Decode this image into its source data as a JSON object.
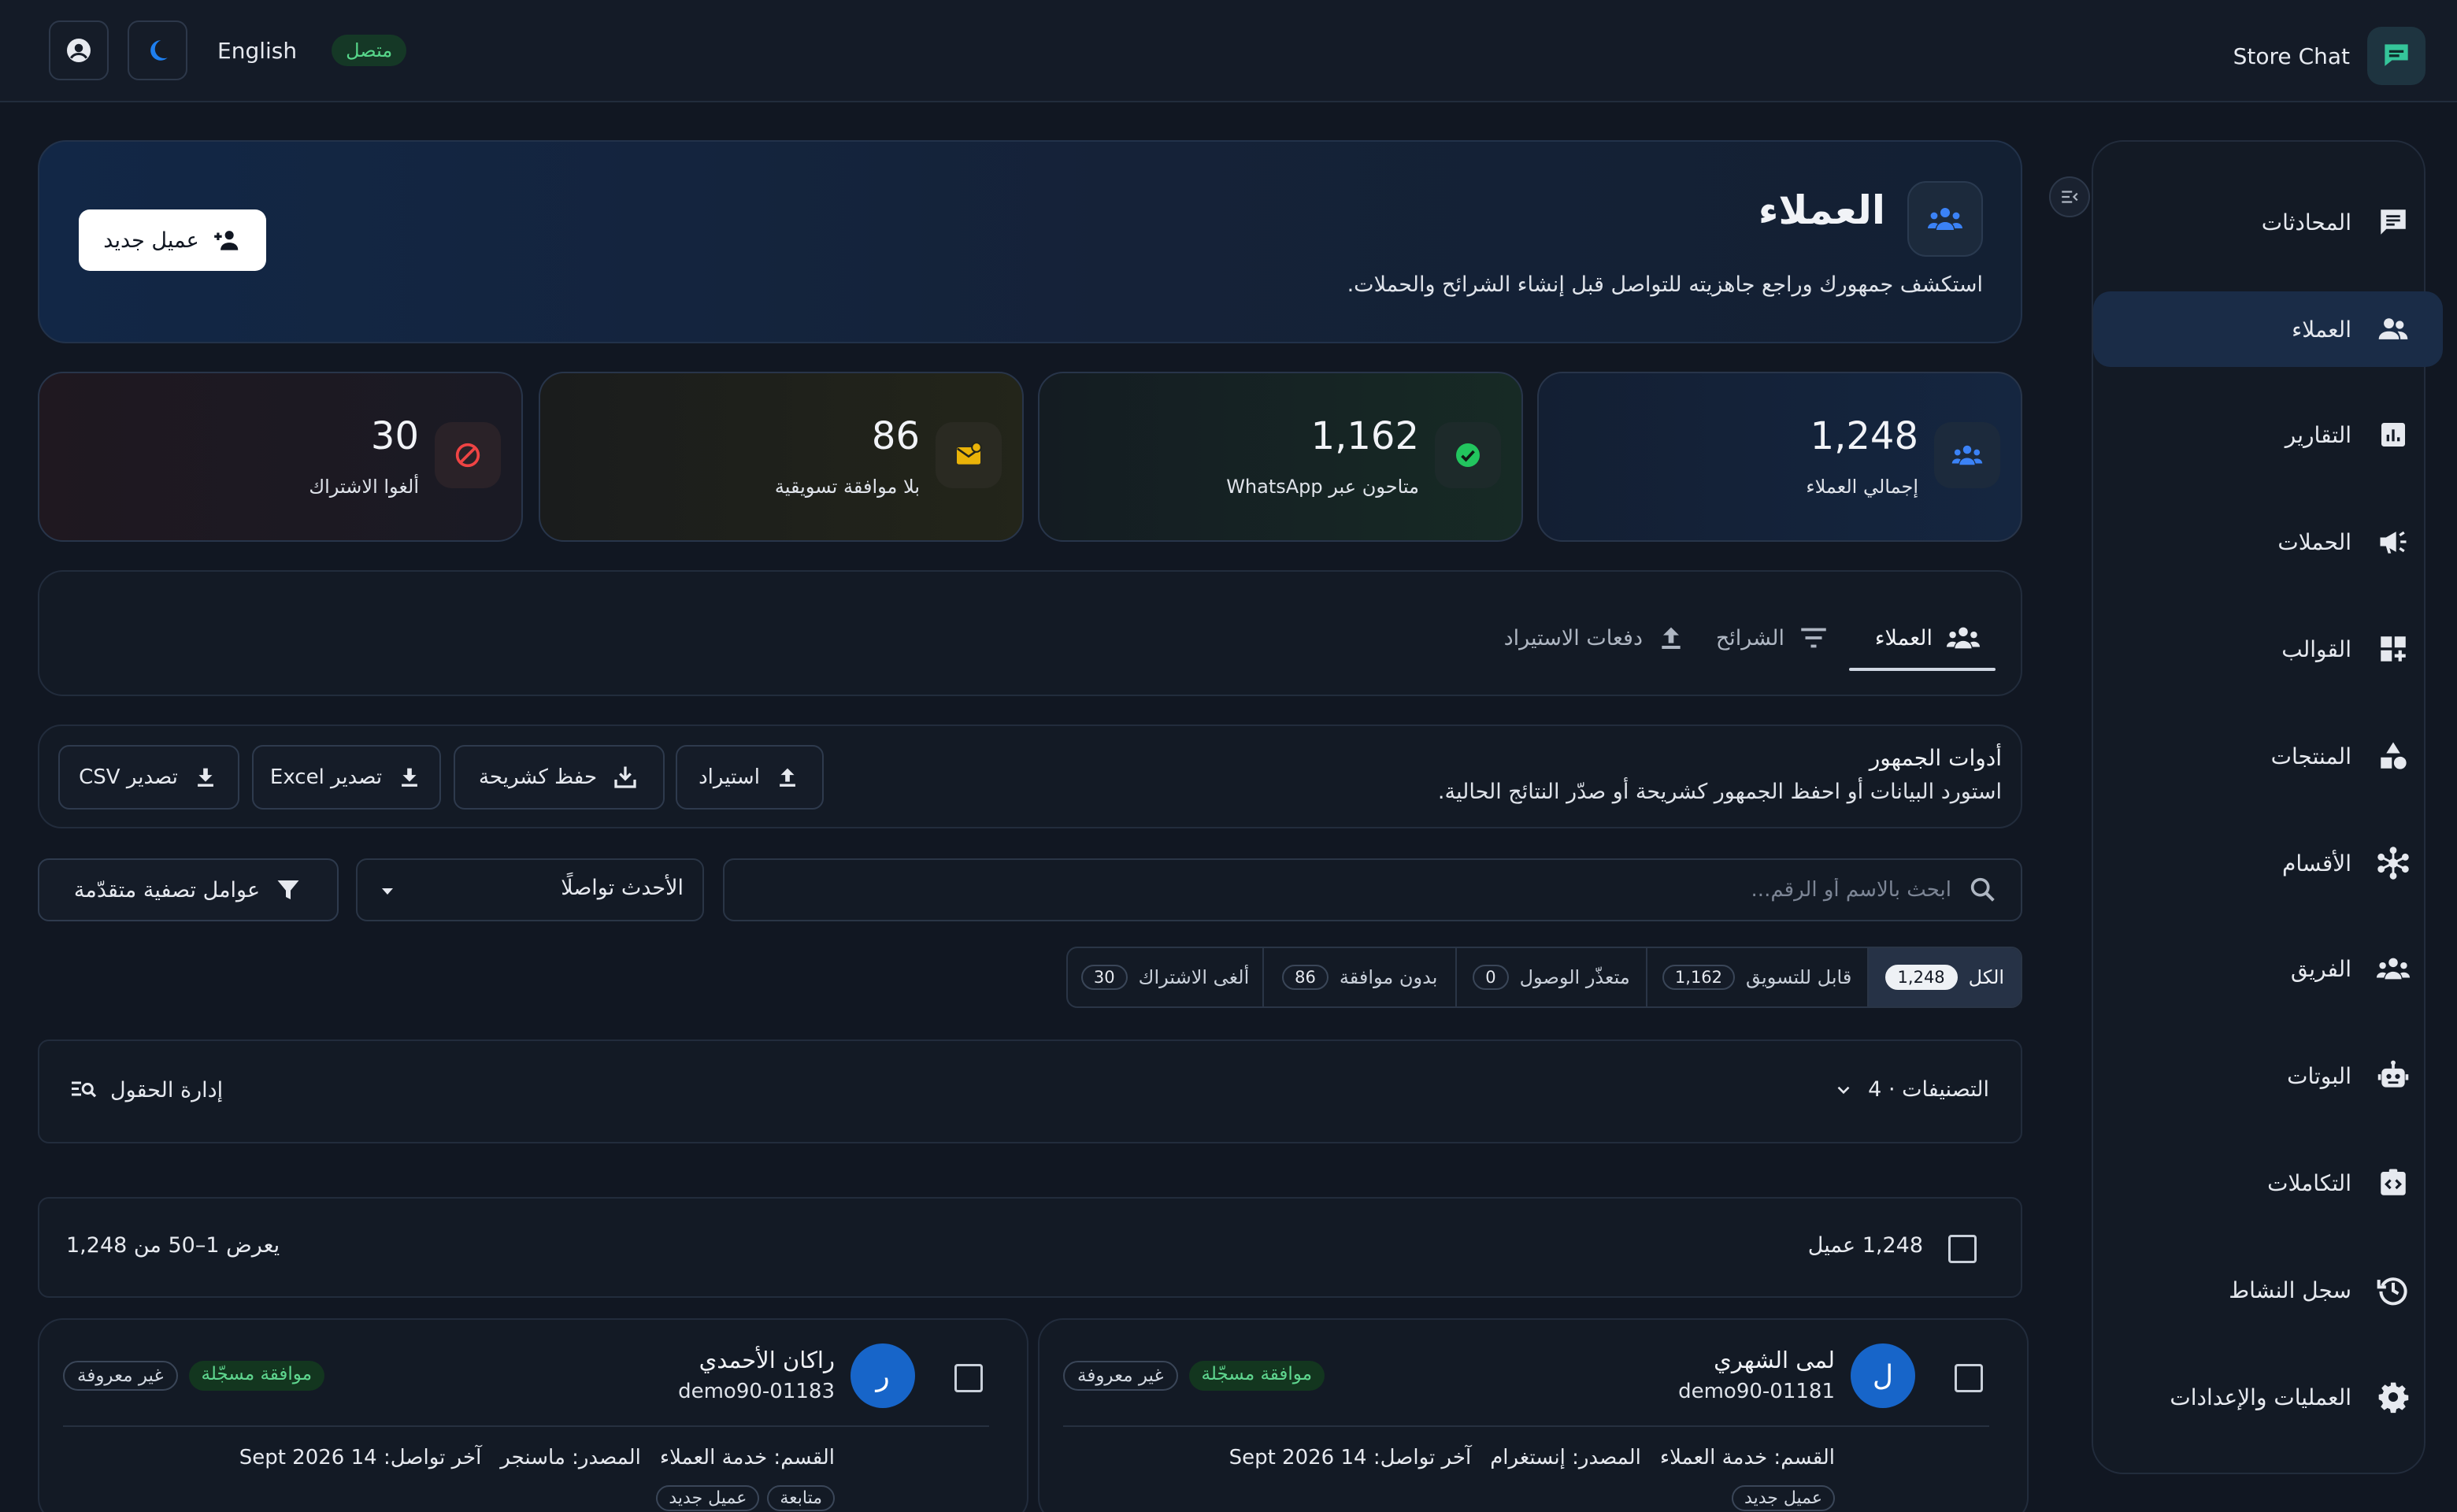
{
  "topbar": {
    "brand": "Store Chat",
    "language": "English",
    "status": "متصل"
  },
  "sidebar": {
    "items": [
      {
        "label": "المحادثات",
        "icon": "chat-icon"
      },
      {
        "label": "العملاء",
        "icon": "people-icon",
        "active": true
      },
      {
        "label": "التقارير",
        "icon": "report-icon"
      },
      {
        "label": "الحملات",
        "icon": "megaphone-icon"
      },
      {
        "label": "القوالب",
        "icon": "template-icon"
      },
      {
        "label": "المنتجات",
        "icon": "shapes-icon"
      },
      {
        "label": "الأقسام",
        "icon": "hub-icon"
      },
      {
        "label": "الفريق",
        "icon": "team-icon"
      },
      {
        "label": "البوتات",
        "icon": "bot-icon"
      },
      {
        "label": "التكاملات",
        "icon": "integration-icon"
      },
      {
        "label": "سجل النشاط",
        "icon": "history-icon"
      },
      {
        "label": "العمليات والإعدادات",
        "icon": "gear-icon"
      }
    ]
  },
  "hero": {
    "title": "العملاء",
    "subtitle": "استكشف جمهورك وراجع جاهزيته للتواصل قبل إنشاء الشرائح والحملات.",
    "new_button": "عميل جديد"
  },
  "stats": [
    {
      "value": "1,248",
      "label": "إجمالي العملاء",
      "color": "#3b82f6"
    },
    {
      "value": "1,162",
      "label": "متاحون عبر WhatsApp",
      "color": "#22c55e"
    },
    {
      "value": "86",
      "label": "بلا موافقة تسويقية",
      "color": "#eab308"
    },
    {
      "value": "30",
      "label": "ألغوا الاشتراك",
      "color": "#ef4444"
    }
  ],
  "tabs": [
    {
      "label": "العملاء",
      "active": true
    },
    {
      "label": "الشرائح"
    },
    {
      "label": "دفعات الاستيراد"
    }
  ],
  "tools": {
    "title": "أدوات الجمهور",
    "subtitle": "استورد البيانات أو احفظ الجمهور كشريحة أو صدّر النتائج الحالية.",
    "import": "استيراد",
    "save_segment": "حفظ كشريحة",
    "export_excel": "تصدير Excel",
    "export_csv": "تصدير CSV"
  },
  "search": {
    "placeholder": "ابحث بالاسم أو الرقم..."
  },
  "sort": {
    "selected": "الأحدث تواصلًا"
  },
  "filter_button": "عوامل تصفية متقدّمة",
  "segments": [
    {
      "label": "الكل",
      "count": "1,248",
      "active": true
    },
    {
      "label": "قابل للتسويق",
      "count": "1,162"
    },
    {
      "label": "متعذّر الوصول",
      "count": "0"
    },
    {
      "label": "بدون موافقة",
      "count": "86"
    },
    {
      "label": "ألغى الاشتراك",
      "count": "30"
    }
  ],
  "categories": {
    "label": "التصنيفات · 4",
    "manage_fields": "إدارة الحقول"
  },
  "list": {
    "count_label": "1,248 عميل",
    "range_label": "يعرض 1–50 من 1,248"
  },
  "customers": [
    {
      "initial": "ل",
      "name": "لمى الشهري",
      "id": "demo90-01181",
      "consent": "موافقة مسجّلة",
      "gender": "غير معروفة",
      "department": "القسم: خدمة العملاء",
      "source": "المصدر: إنستغرام",
      "last_contact": "آخر تواصل: 14 Sept 2026",
      "tags": [
        "عميل جديد"
      ]
    },
    {
      "initial": "ر",
      "name": "راكان الأحمدي",
      "id": "demo90-01183",
      "consent": "موافقة مسجّلة",
      "gender": "غير معروفة",
      "department": "القسم: خدمة العملاء",
      "source": "المصدر: ماسنجر",
      "last_contact": "آخر تواصل: 14 Sept 2026",
      "tags": [
        "متابعة",
        "عميل جديد"
      ]
    }
  ]
}
